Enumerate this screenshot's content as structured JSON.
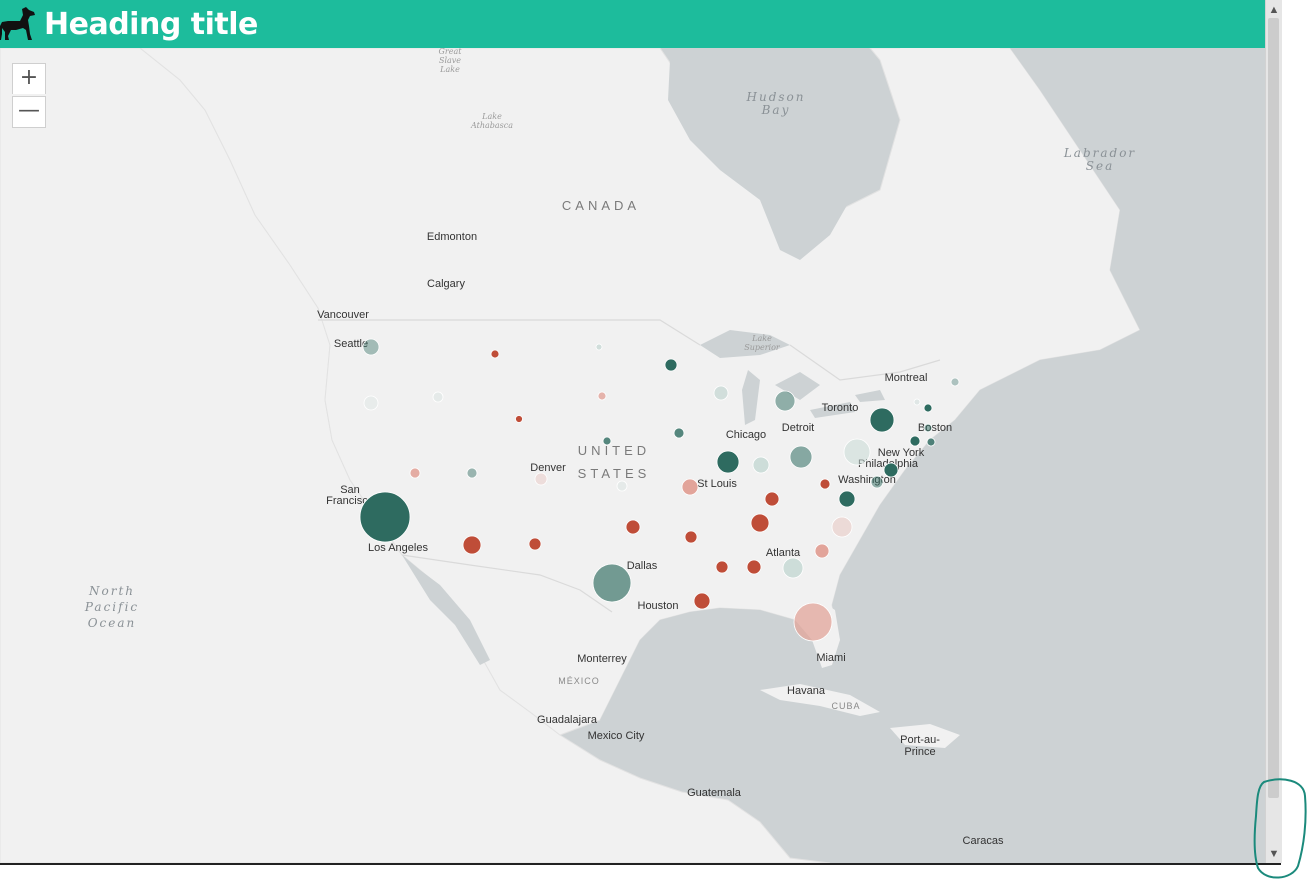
{
  "header": {
    "title": "Heading title",
    "icon": "dog-icon",
    "background": "#1dbc9c"
  },
  "zoom": {
    "in_label": "+",
    "out_label": "—"
  },
  "map": {
    "colors": {
      "land": "#f2f2f2",
      "water": "#cdd2d4",
      "dark": "#2e6b60",
      "light": "#c9dad6",
      "red": "#bf4d38",
      "pink": "#e2a49a"
    },
    "water_labels": [
      {
        "id": "hudson-bay",
        "lines": [
          "Hudson",
          "Bay"
        ]
      },
      {
        "id": "labrador-sea",
        "lines": [
          "Labrador",
          "Sea"
        ]
      },
      {
        "id": "north-pacific-ocean",
        "lines": [
          "North",
          "Pacific",
          "Ocean"
        ]
      }
    ],
    "lake_labels": [
      {
        "id": "great-slave-lake",
        "lines": [
          "Great",
          "Slave",
          "Lake"
        ]
      },
      {
        "id": "lake-athabasca",
        "lines": [
          "Lake",
          "Athabasca"
        ]
      },
      {
        "id": "lake-superior",
        "lines": [
          "Lake",
          "Superior"
        ]
      }
    ],
    "country_labels": [
      {
        "id": "canada",
        "lines": [
          "CANADA"
        ]
      },
      {
        "id": "united-states",
        "lines": [
          "UNITED",
          "STATES"
        ]
      }
    ],
    "small_country_labels": [
      {
        "id": "mexico",
        "text": "MÉXICO"
      },
      {
        "id": "cuba",
        "text": "CUBA"
      }
    ],
    "city_labels": [
      {
        "id": "edmonton",
        "lines": [
          "Edmonton"
        ]
      },
      {
        "id": "calgary",
        "lines": [
          "Calgary"
        ]
      },
      {
        "id": "vancouver",
        "lines": [
          "Vancouver"
        ]
      },
      {
        "id": "seattle",
        "lines": [
          "Seattle"
        ]
      },
      {
        "id": "montreal",
        "lines": [
          "Montreal"
        ]
      },
      {
        "id": "toronto",
        "lines": [
          "Toronto"
        ]
      },
      {
        "id": "boston",
        "lines": [
          "Boston"
        ]
      },
      {
        "id": "chicago",
        "lines": [
          "Chicago"
        ]
      },
      {
        "id": "detroit",
        "lines": [
          "Detroit"
        ]
      },
      {
        "id": "new-york",
        "lines": [
          "New York"
        ]
      },
      {
        "id": "philadelphia",
        "lines": [
          "Philadelphia"
        ]
      },
      {
        "id": "washington",
        "lines": [
          "Washington"
        ]
      },
      {
        "id": "denver",
        "lines": [
          "Denver"
        ]
      },
      {
        "id": "st-louis",
        "lines": [
          "St Louis"
        ]
      },
      {
        "id": "san-francisco",
        "lines": [
          "San",
          "Francisco"
        ]
      },
      {
        "id": "los-angeles",
        "lines": [
          "Los Angeles"
        ]
      },
      {
        "id": "atlanta",
        "lines": [
          "Atlanta"
        ]
      },
      {
        "id": "dallas",
        "lines": [
          "Dallas"
        ]
      },
      {
        "id": "houston",
        "lines": [
          "Houston"
        ]
      },
      {
        "id": "miami",
        "lines": [
          "Miami"
        ]
      },
      {
        "id": "monterrey",
        "lines": [
          "Monterrey"
        ]
      },
      {
        "id": "havana",
        "lines": [
          "Havana"
        ]
      },
      {
        "id": "guadalajara",
        "lines": [
          "Guadalajara"
        ]
      },
      {
        "id": "mexico-city",
        "lines": [
          "Mexico City"
        ]
      },
      {
        "id": "port-au-prince",
        "lines": [
          "Port-au-",
          "Prince"
        ]
      },
      {
        "id": "guatemala",
        "lines": [
          "Guatemala"
        ]
      },
      {
        "id": "caracas",
        "lines": [
          "Caracas"
        ]
      }
    ]
  },
  "scrollbar": {
    "up_icon": "chevron-up-icon",
    "down_icon": "chevron-down-icon"
  }
}
